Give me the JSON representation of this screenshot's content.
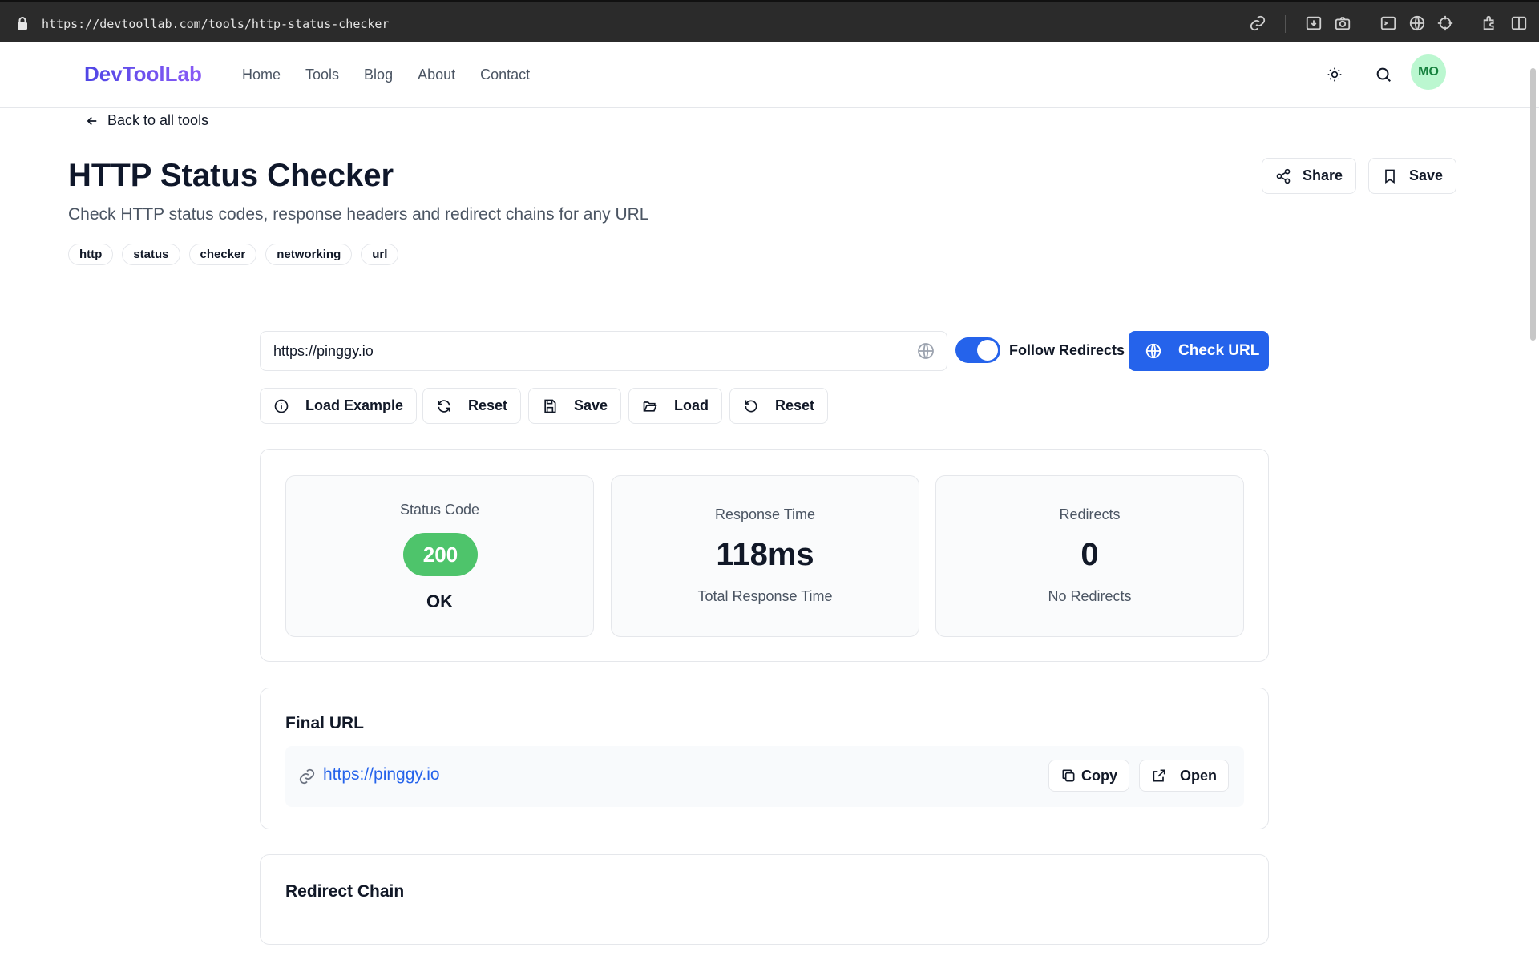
{
  "browser": {
    "url": "https://devtoollab.com/tools/http-status-checker"
  },
  "header": {
    "logo": "DevToolLab",
    "nav": [
      "Home",
      "Tools",
      "Blog",
      "About",
      "Contact"
    ],
    "avatar_initials": "MO"
  },
  "back_link": "Back to all tools",
  "page": {
    "title": "HTTP Status Checker",
    "subtitle": "Check HTTP status codes, response headers and redirect chains for any URL",
    "tags": [
      "http",
      "status",
      "checker",
      "networking",
      "url"
    ],
    "share_label": "Share",
    "save_label": "Save"
  },
  "form": {
    "url_value": "https://pinggy.io",
    "follow_redirects_label": "Follow Redirects",
    "follow_redirects_on": true,
    "check_label": "Check URL"
  },
  "actions": {
    "load_example": "Load Example",
    "reset": "Reset",
    "save": "Save",
    "load": "Load",
    "reset2": "Reset"
  },
  "stats": {
    "status_label": "Status Code",
    "status_code": "200",
    "status_text": "OK",
    "response_label": "Response Time",
    "response_value": "118ms",
    "response_sub": "Total Response Time",
    "redirects_label": "Redirects",
    "redirects_value": "0",
    "redirects_sub": "No Redirects"
  },
  "final_url": {
    "title": "Final URL",
    "url": "https://pinggy.io",
    "copy_label": "Copy",
    "open_label": "Open"
  },
  "redirect_chain": {
    "title": "Redirect Chain"
  },
  "colors": {
    "accent": "#2563eb",
    "success": "#4ec46b",
    "logo_start": "#4f46e5",
    "logo_end": "#8b5cf6"
  }
}
